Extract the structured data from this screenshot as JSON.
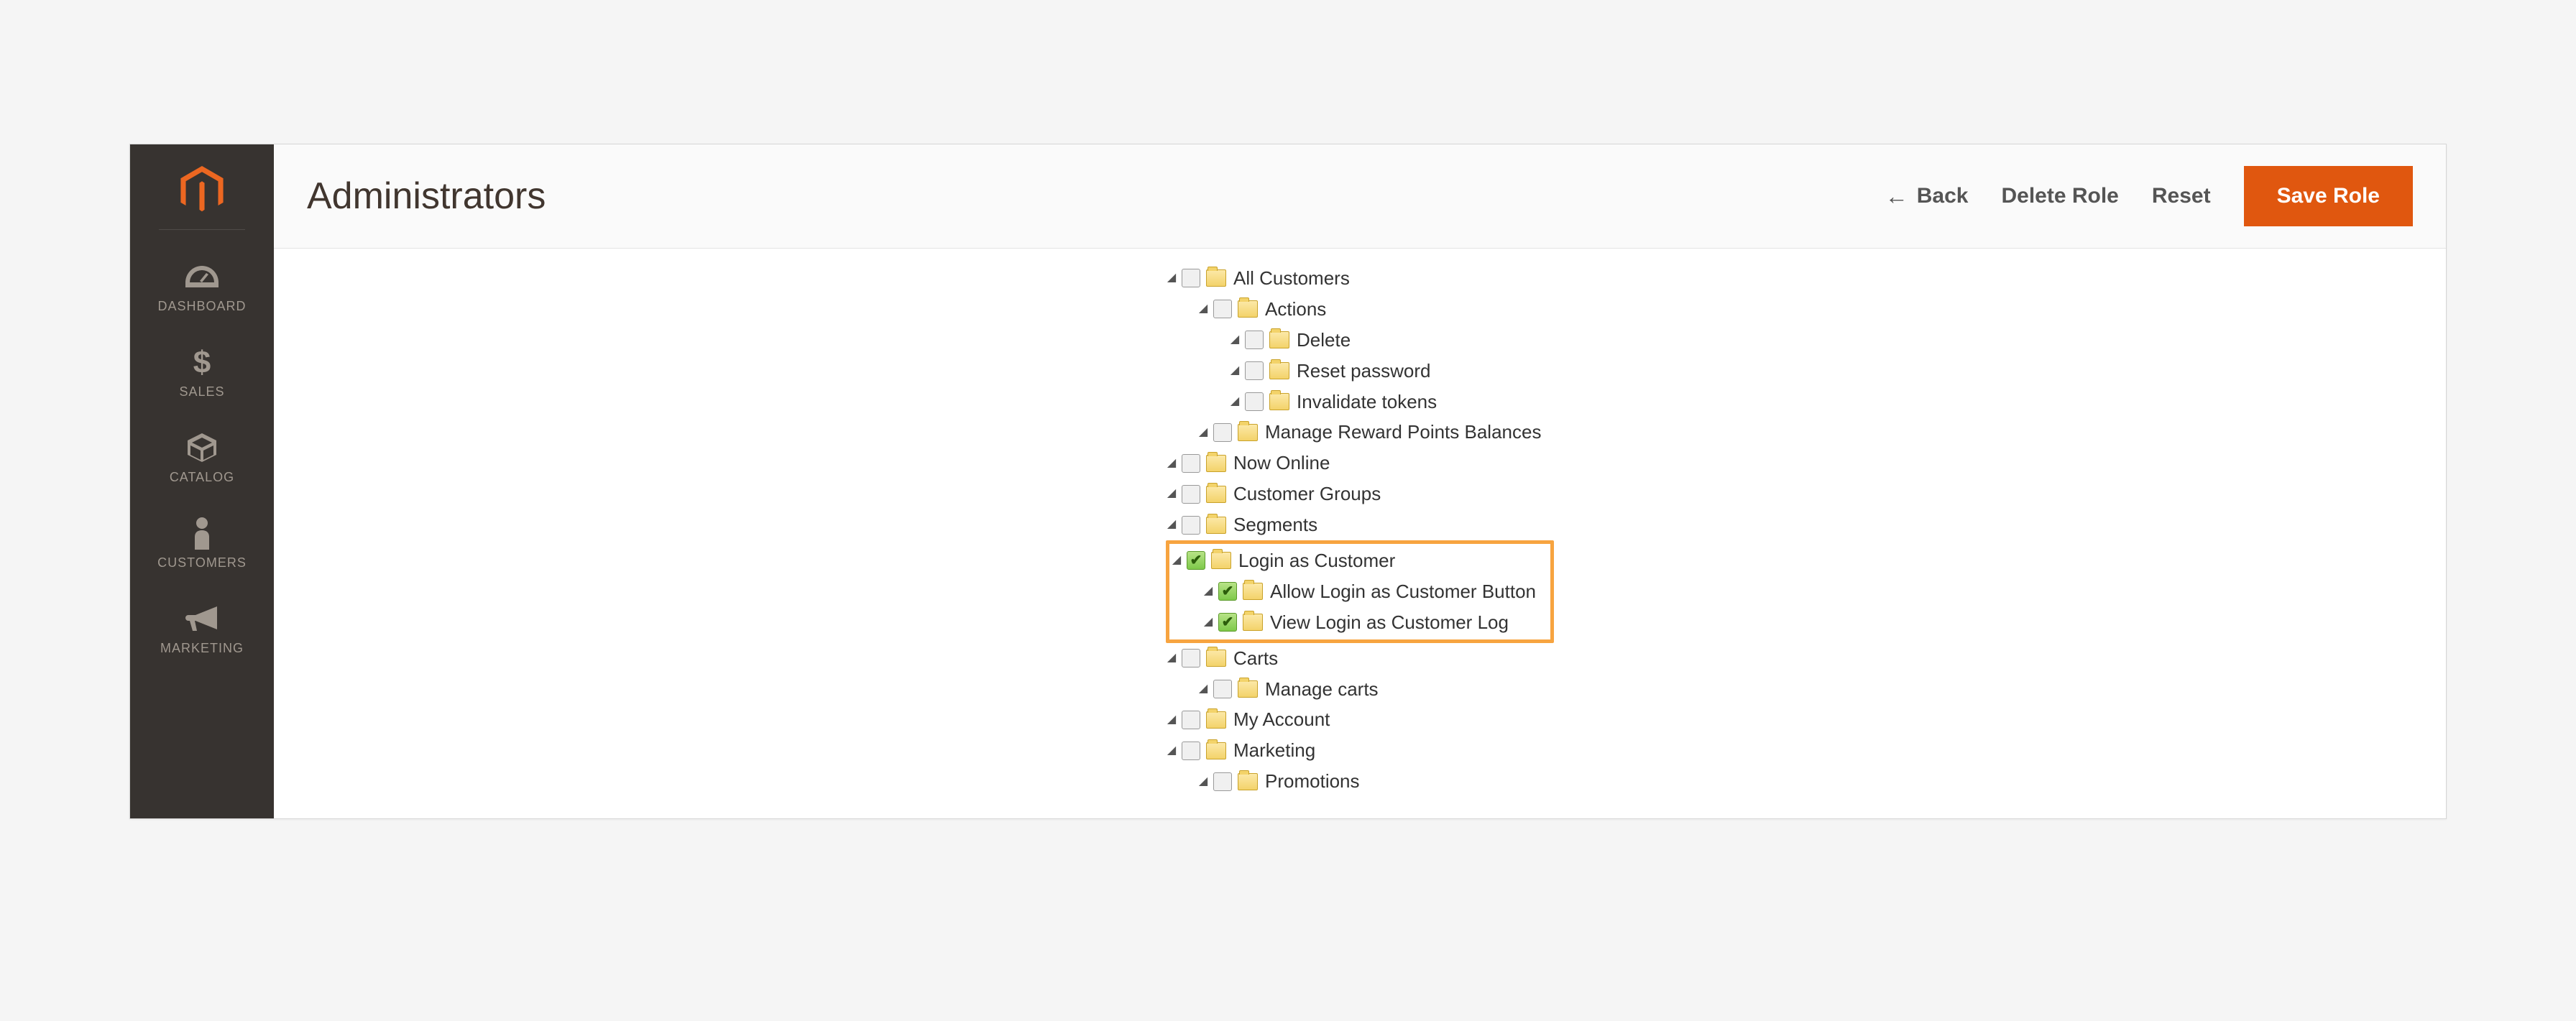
{
  "header": {
    "title": "Administrators",
    "back": "Back",
    "delete": "Delete Role",
    "reset": "Reset",
    "save": "Save Role"
  },
  "sidebar": {
    "items": [
      {
        "id": "dashboard",
        "label": "DASHBOARD"
      },
      {
        "id": "sales",
        "label": "SALES"
      },
      {
        "id": "catalog",
        "label": "CATALOG"
      },
      {
        "id": "customers",
        "label": "CUSTOMERS"
      },
      {
        "id": "marketing",
        "label": "MARKETING"
      }
    ]
  },
  "tree": {
    "all_customers": "All Customers",
    "actions": "Actions",
    "delete": "Delete",
    "reset_password": "Reset password",
    "invalidate_tokens": "Invalidate tokens",
    "manage_reward": "Manage Reward Points Balances",
    "now_online": "Now Online",
    "customer_groups": "Customer Groups",
    "segments": "Segments",
    "login_as_customer": "Login as Customer",
    "allow_login_button": "Allow Login as Customer Button",
    "view_login_log": "View Login as Customer Log",
    "carts": "Carts",
    "manage_carts": "Manage carts",
    "my_account": "My Account",
    "marketing": "Marketing",
    "promotions": "Promotions"
  }
}
